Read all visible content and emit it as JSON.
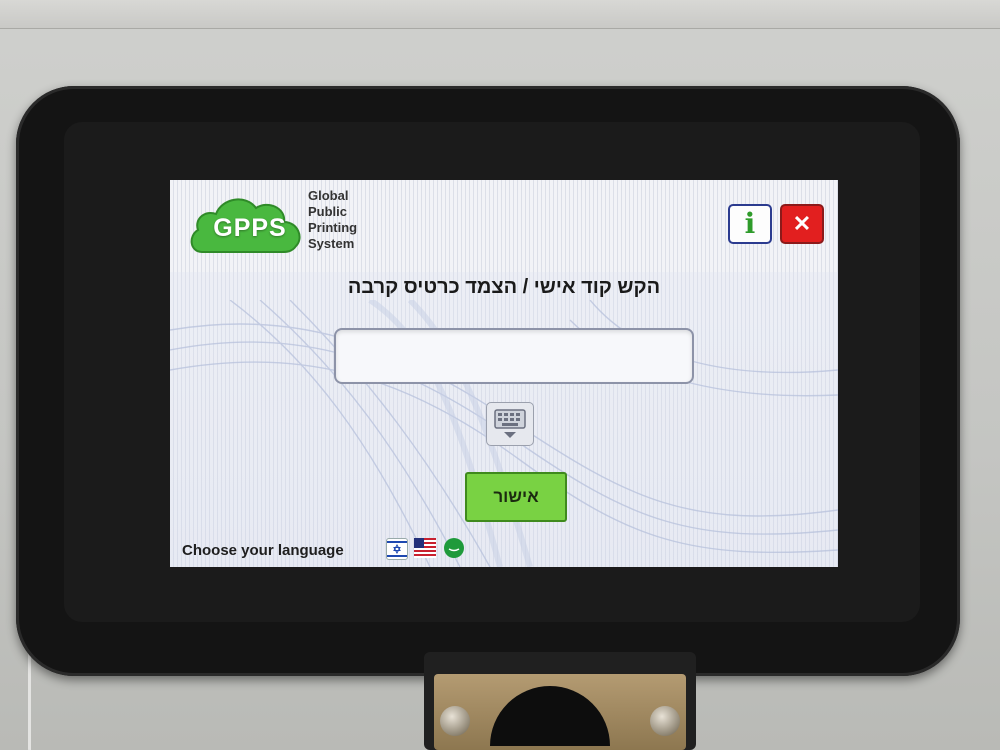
{
  "brand": {
    "logo_text": "GPPS",
    "line1": "Global",
    "line2": "Public",
    "line3": "Printing",
    "line4": "System"
  },
  "header": {
    "info_label": "i",
    "close_label": "✕"
  },
  "main": {
    "prompt": "הקש קוד אישי / הצמד כרטיס קרבה",
    "code_value": "",
    "confirm_label": "אישור"
  },
  "footer": {
    "language_label": "Choose your language",
    "languages": [
      "hebrew-flag-icon",
      "us-flag-icon",
      "arabic-flag-icon"
    ]
  },
  "colors": {
    "confirm": "#79d243",
    "close": "#e21f1f",
    "brand_green": "#3aa534",
    "info_border": "#2b3b8f"
  }
}
